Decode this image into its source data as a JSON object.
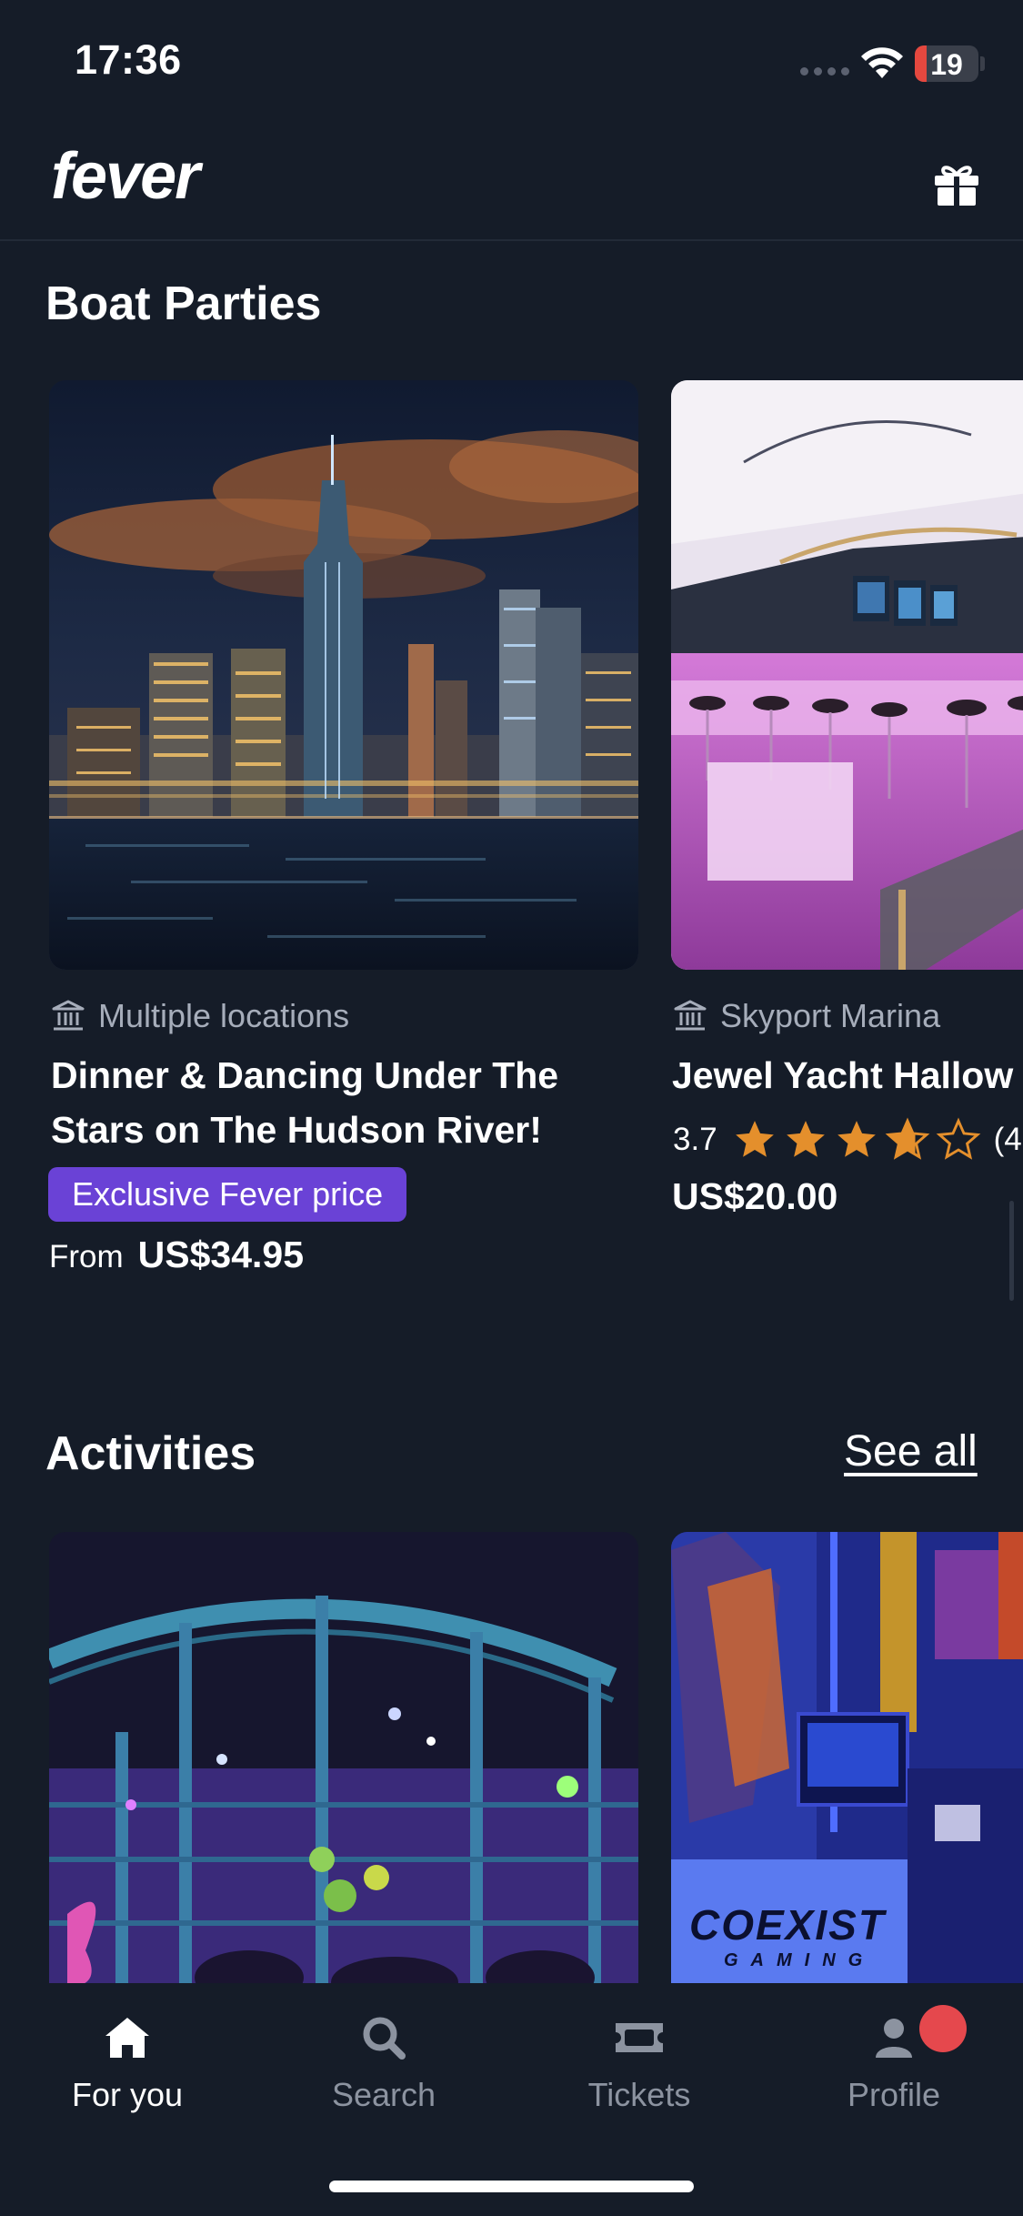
{
  "status_bar": {
    "time": "17:36",
    "battery": "19",
    "battery_level": 0.19
  },
  "header": {
    "logo": "fever",
    "gift_icon": "gift-icon"
  },
  "sections": [
    {
      "title": "Boat Parties",
      "cards": [
        {
          "venue": "Multiple locations",
          "title_line1": "Dinner & Dancing Under The",
          "title_line2": "Stars on The Hudson River!",
          "badge": "Exclusive Fever price",
          "price_prefix": "From",
          "price": "US$34.95",
          "image": "city-skyline-night"
        },
        {
          "venue": "Skyport Marina",
          "title": "Jewel Yacht Hallow",
          "rating": "3.7",
          "stars_filled": 3.7,
          "rating_count": "(4",
          "price": "US$20.00",
          "image": "yacht-bar-interior"
        }
      ]
    },
    {
      "title": "Activities",
      "see_all": "See all",
      "cards": [
        {
          "image": "ropes-course-arena"
        },
        {
          "image": "coexist-gaming"
        }
      ]
    }
  ],
  "image_text": {
    "coexist_logo": "COEXIST",
    "coexist_sub": "GAMING"
  },
  "tab_bar": {
    "tabs": [
      {
        "label": "For you",
        "icon": "home-icon",
        "active": true
      },
      {
        "label": "Search",
        "icon": "search-icon",
        "active": false
      },
      {
        "label": "Tickets",
        "icon": "ticket-icon",
        "active": false
      },
      {
        "label": "Profile",
        "icon": "profile-icon",
        "active": false
      }
    ]
  },
  "colors": {
    "background": "#151c28",
    "accent": "#6a42d6",
    "star": "#e48f2c",
    "notification": "#e5484d"
  }
}
